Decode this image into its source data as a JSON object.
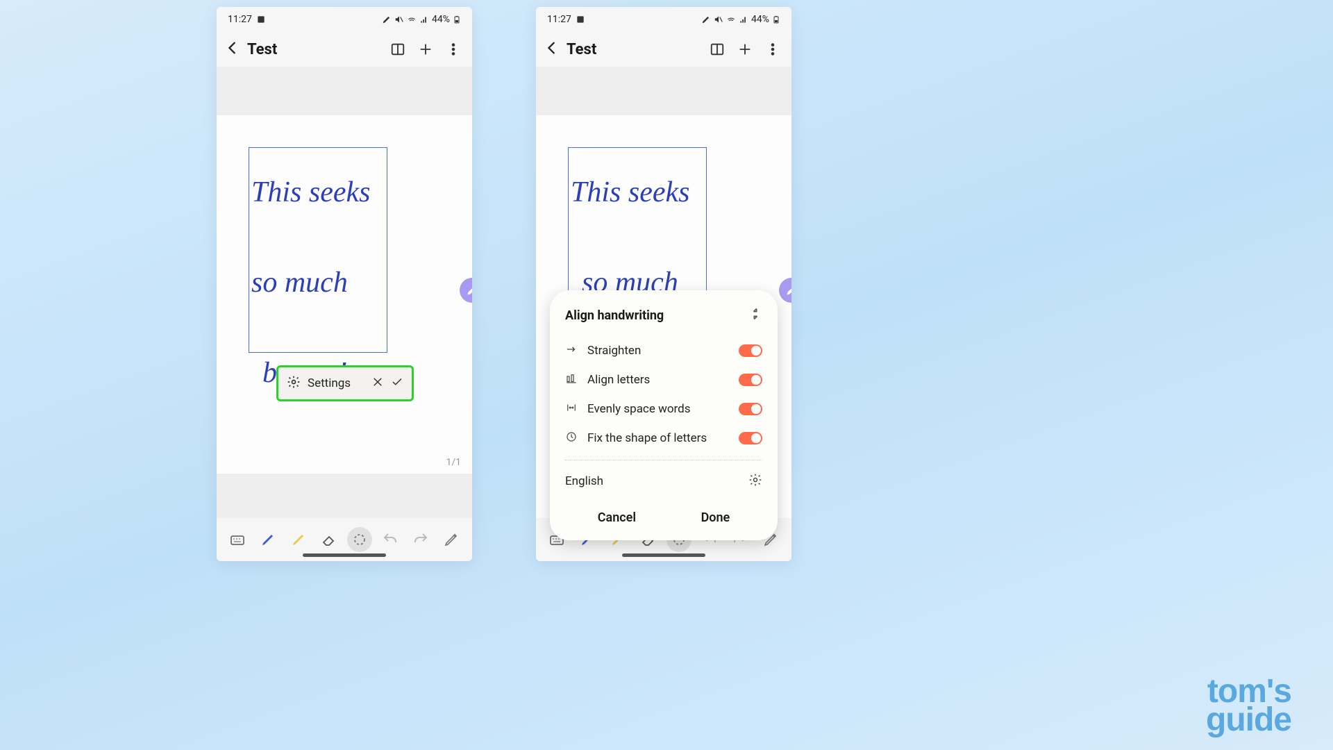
{
  "statusbar": {
    "time": "11:27",
    "battery_label": "44%"
  },
  "header": {
    "title": "Test"
  },
  "handwriting": {
    "line1": "This seeks",
    "line2": "so much",
    "line3": "better !"
  },
  "page_counter": "1/1",
  "popup": {
    "settings_label": "Settings"
  },
  "panel": {
    "title": "Align handwriting",
    "options": [
      {
        "label": "Straighten",
        "on": true
      },
      {
        "label": "Align letters",
        "on": true
      },
      {
        "label": "Evenly space words",
        "on": true
      },
      {
        "label": "Fix the shape of letters",
        "on": true
      }
    ],
    "language": "English",
    "cancel": "Cancel",
    "done": "Done"
  },
  "watermark": {
    "line1": "tom's",
    "line2": "guide"
  }
}
